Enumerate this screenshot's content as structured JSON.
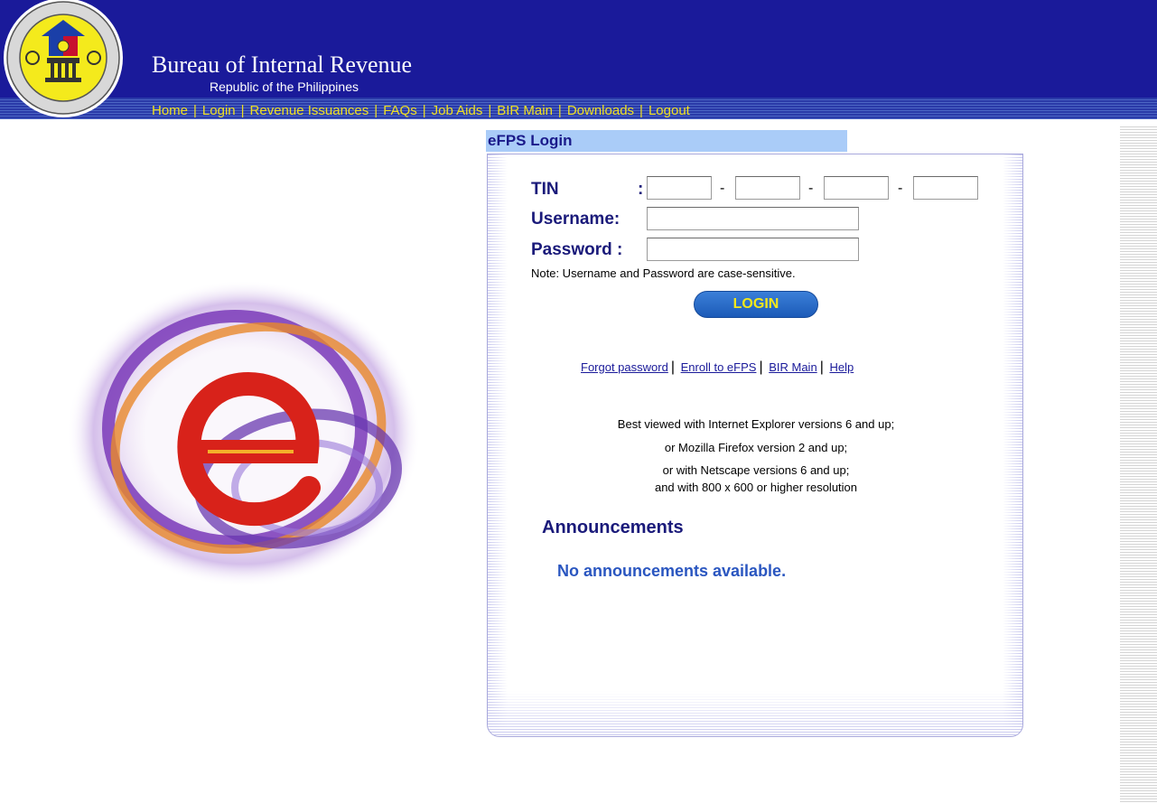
{
  "header": {
    "title": "Bureau of Internal Revenue",
    "subtitle": "Republic of the Philippines",
    "nav": [
      {
        "label": "Home"
      },
      {
        "label": "Login"
      },
      {
        "label": "Revenue Issuances"
      },
      {
        "label": "FAQs"
      },
      {
        "label": "Job Aids"
      },
      {
        "label": "BIR Main"
      },
      {
        "label": "Downloads"
      },
      {
        "label": "Logout"
      }
    ]
  },
  "login": {
    "panel_title": "eFPS Login",
    "tin_label": "TIN",
    "tin_colon": ":",
    "tin_dash": "-",
    "username_label": "Username:",
    "password_label": "Password :",
    "tin_values": [
      "",
      "",
      "",
      ""
    ],
    "username_value": "",
    "password_value": "",
    "note": "Note: Username and Password are case-sensitive.",
    "button_label": "LOGIN"
  },
  "links": {
    "forgot": "Forgot password",
    "enroll": "Enroll to eFPS",
    "bir_main": "BIR Main",
    "help": "Help",
    "sep": "|"
  },
  "compatibility": [
    "Best viewed with Internet Explorer versions 6 and up;",
    "or Mozilla Firefox version 2 and up;",
    "or with Netscape versions 6 and up;",
    "and with 800 x 600 or higher resolution"
  ],
  "announcements": {
    "title": "Announcements",
    "empty_text": "No announcements available."
  },
  "colors": {
    "header_bg": "#1a1a9a",
    "nav_text": "#f0e020",
    "panel_title_bg": "#aaccf8",
    "button_bg": "#2a6cc8",
    "button_text": "#f4e81a"
  },
  "icons": {
    "seal": "bir-seal-icon",
    "logo": "efps-e-logo-icon"
  }
}
